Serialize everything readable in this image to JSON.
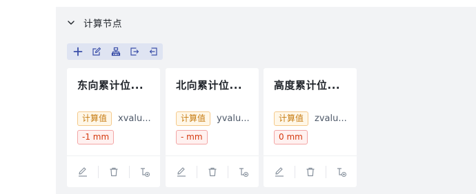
{
  "section": {
    "title": "计算节点",
    "chevron_icon": "chevron-down-icon"
  },
  "toolbar": {
    "buttons": [
      {
        "icon": "plus-icon",
        "color": "#3a4ea8"
      },
      {
        "icon": "edit-icon",
        "color": "#3a4ea8"
      },
      {
        "icon": "node-tree-icon",
        "color": "#3a4ea8"
      },
      {
        "icon": "export-icon",
        "color": "#3a4ea8"
      },
      {
        "icon": "import-icon",
        "color": "#3a4ea8"
      }
    ]
  },
  "cards": [
    {
      "title": "东向累计位...",
      "type_tag": "计算值",
      "variable": "xvalu...",
      "value": "-1 mm"
    },
    {
      "title": "北向累计位...",
      "type_tag": "计算值",
      "variable": "yvalu...",
      "value": "- mm"
    },
    {
      "title": "高度累计位...",
      "type_tag": "计算值",
      "variable": "zvalu...",
      "value": "0 mm"
    }
  ],
  "card_actions": [
    "edit-icon",
    "delete-icon",
    "add-child-node-icon"
  ],
  "colors": {
    "panel_bg": "#f2f3f5",
    "toolbar_bg": "#dfe4f2",
    "accent": "#3a4ea8",
    "calc_tag": "#c77c12",
    "value_tag": "#d4380d"
  }
}
